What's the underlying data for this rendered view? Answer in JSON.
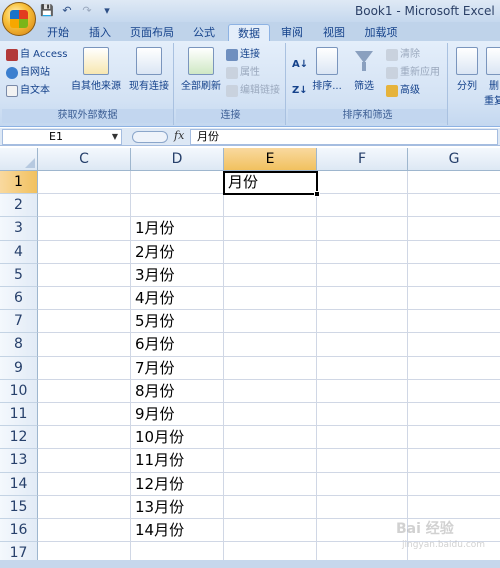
{
  "title_bar": {
    "title": "Book1 - Microsoft Excel",
    "qat_icons": [
      "save-icon",
      "undo-icon",
      "redo-icon",
      "customize-icon"
    ]
  },
  "tabs": [
    {
      "label": "开始",
      "active": false
    },
    {
      "label": "插入",
      "active": false
    },
    {
      "label": "页面布局",
      "active": false
    },
    {
      "label": "公式",
      "active": false
    },
    {
      "label": "数据",
      "active": true
    },
    {
      "label": "审阅",
      "active": false
    },
    {
      "label": "视图",
      "active": false
    },
    {
      "label": "加载项",
      "active": false
    }
  ],
  "ribbon": {
    "external_data": {
      "label": "获取外部数据",
      "from_access": "自 Access",
      "from_web": "自网站",
      "from_text": "自文本",
      "other_sources": "自其他来源",
      "existing": "现有连接"
    },
    "connections": {
      "label": "连接",
      "refresh_all": "全部刷新",
      "connections": "连接",
      "properties": "属性",
      "edit_links": "编辑链接"
    },
    "sort_filter": {
      "label": "排序和筛选",
      "sort": "排序...",
      "filter": "筛选",
      "clear": "清除",
      "reapply": "重新应用",
      "advanced": "高级"
    },
    "data_tools": {
      "split": "分列",
      "remove_dup_a": "删",
      "remove_dup_b": "重复"
    }
  },
  "formula_bar": {
    "name_box": "E1",
    "fx": "fx",
    "formula": "月份"
  },
  "grid": {
    "columns": [
      "C",
      "D",
      "E",
      "F",
      "G"
    ],
    "selected_column": "E",
    "rows": [
      "1",
      "2",
      "3",
      "4",
      "5",
      "6",
      "7",
      "8",
      "9",
      "10",
      "11",
      "12",
      "13",
      "14",
      "15",
      "16",
      "17"
    ],
    "selected_row": "1",
    "e1": "月份",
    "d_values": [
      "1月份",
      "2月份",
      "3月份",
      "4月份",
      "5月份",
      "6月份",
      "7月份",
      "8月份",
      "9月份",
      "10月份",
      "11月份",
      "12月份",
      "13月份",
      "14月份"
    ]
  },
  "watermark": {
    "text": "Bai 经验",
    "sub": "jingyan.baidu.com"
  }
}
